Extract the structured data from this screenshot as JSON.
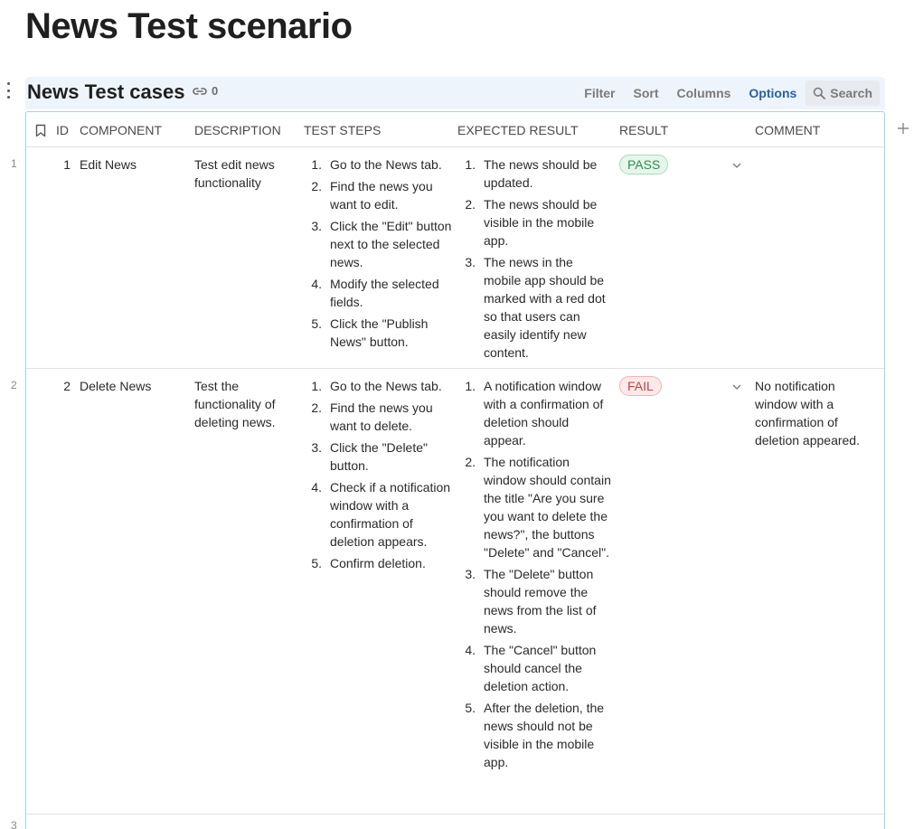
{
  "page": {
    "title": "News Test scenario"
  },
  "database": {
    "title": "News Test cases",
    "link_count": "0",
    "toolbar": {
      "filter": "Filter",
      "sort": "Sort",
      "columns": "Columns",
      "options": "Options",
      "search": "Search"
    }
  },
  "columns": [
    "ID",
    "COMPONENT",
    "DESCRIPTION",
    "TEST STEPS",
    "EXPECTED RESULT",
    "RESULT",
    "COMMENT"
  ],
  "rows": [
    {
      "row_number": "1",
      "id": "1",
      "component": "Edit News",
      "description": "Test edit news functionality",
      "steps": [
        "Go to the News tab.",
        "Find the news you want to edit.",
        "Click the \"Edit\" button next to the selected news.",
        "Modify the selected fields.",
        "Click the \"Publish News\" button."
      ],
      "expected": [
        "The news should be updated.",
        "The news should be visible in the mobile app.",
        "The news in the mobile app should be marked with a red dot so that users can easily identify new content."
      ],
      "result": "PASS",
      "comment": ""
    },
    {
      "row_number": "2",
      "id": "2",
      "component": "Delete News",
      "description": "Test the functionality of deleting news.",
      "steps": [
        "Go to the News tab.",
        "Find the news you want to delete.",
        "Click the \"Delete\" button.",
        "Check if a notification window with a confirmation of deletion appears.",
        "Confirm deletion."
      ],
      "expected": [
        "A notification window with a confirmation of deletion should appear.",
        "The notification window should contain the title \"Are you sure you want to delete the news?\", the buttons \"Delete\" and \"Cancel\".",
        "The \"Delete\" button should remove the news from the list of news.",
        "The \"Cancel\" button should cancel the deletion action.",
        "After the deletion, the news should not be visible in the mobile app."
      ],
      "result": "FAIL",
      "comment": "No notification window with a confirmation of deletion appeared."
    }
  ],
  "next_row_number": "3",
  "colors": {
    "pass": "#2f8a4f",
    "fail": "#c24242",
    "accent": "#2a5ea8",
    "border": "#9cd6e4"
  }
}
